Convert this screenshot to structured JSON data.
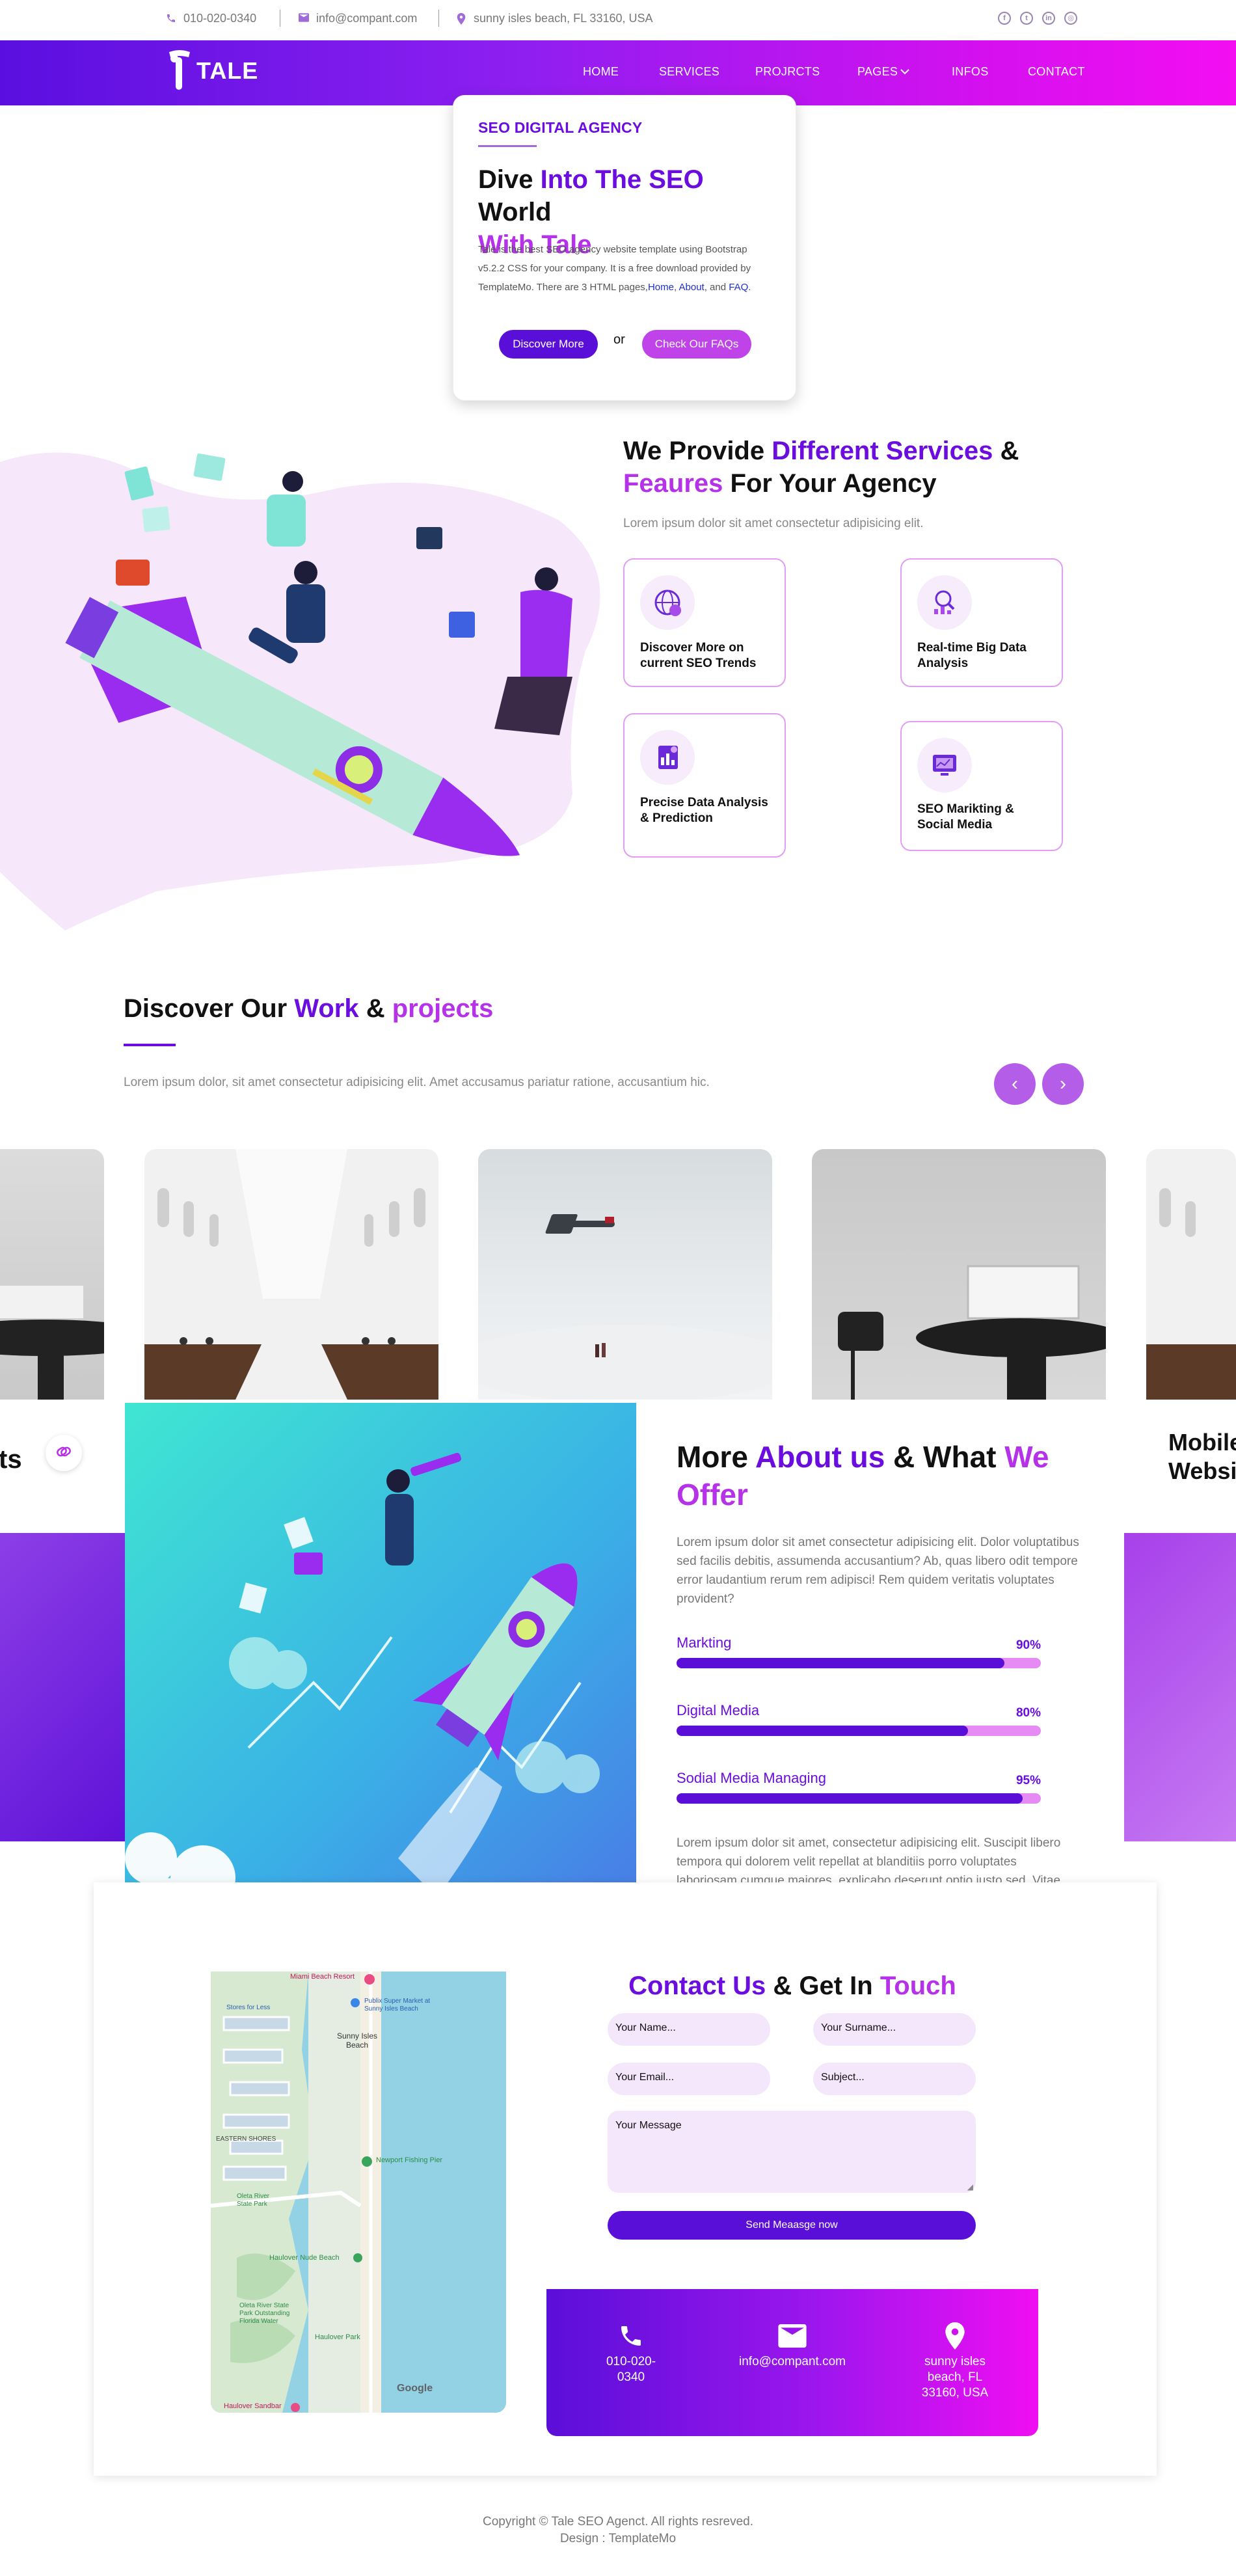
{
  "topbar": {
    "phone": "010-020-0340",
    "email": "info@compant.com",
    "address": "sunny isles beach, FL 33160, USA",
    "social_icons": [
      "facebook-icon",
      "twitter-icon",
      "linkedin-icon",
      "instagram-icon"
    ]
  },
  "brand": {
    "name": "TALE"
  },
  "nav": {
    "items": [
      {
        "label": "HOME"
      },
      {
        "label": "SERVICES"
      },
      {
        "label": "PROJRCTS"
      },
      {
        "label": "PAGES"
      },
      {
        "label": "INFOS"
      },
      {
        "label": "CONTACT"
      }
    ]
  },
  "hero": {
    "kicker": "SEO DIGITAL AGENCY",
    "title_part1": "Dive ",
    "title_part2": "Into The SEO",
    "title_part3": " World",
    "title_part4": "With Tale",
    "desc_text": "Tale is the best SEO agency website template using Bootstrap v5.2.2 CSS for your company. It is a free download provided by TemplateMo. There are 3 HTML pages,",
    "link_home": "Home",
    "link_about": "About",
    "link_and": ", and ",
    "link_faq": "FAQ",
    "primary_button": "Discover More",
    "or_text": "or",
    "secondary_button": "Check Our FAQs"
  },
  "services": {
    "title_part1": "We Provide ",
    "title_part2": "Different Services",
    "title_part3": " &",
    "title_part4": "Feaures",
    "title_part5": " For Your Agency",
    "subtitle": "Lorem ipsum dolor sit amet consectetur adipisicing elit.",
    "cards": [
      {
        "label": "Discover More on current SEO Trends"
      },
      {
        "label": "Real-time Big Data Analysis"
      },
      {
        "label": "Precise Data Analysis & Prediction"
      },
      {
        "label": "SEO Marikting & Social Media"
      }
    ]
  },
  "work": {
    "title_part1": "Discover Our ",
    "title_part2": "Work",
    "title_part3": " & ",
    "title_part4": "projects",
    "subtitle": "Lorem ipsum dolor, sit amet consectetur adipisicing elit. Amet accusamus pariatur ratione, accusantium hic.",
    "prev_icon": "‹",
    "next_icon": "›",
    "left_card_text": "ts",
    "right_card_text_1": "Mobile",
    "right_card_text_2": "Websi"
  },
  "about": {
    "title_part1": "More ",
    "title_part2": "About us",
    "title_part3": " & What ",
    "title_part4": "We",
    "title_part5": "Offer",
    "desc": "Lorem ipsum dolor sit amet consectetur adipisicing elit. Dolor voluptatibus sed facilis debitis, assumenda accusantium? Ab, quas libero odit tempore error laudantium rerum rem adipisci! Rem quidem veritatis voluptates provident?",
    "skills": [
      {
        "label": "Markting",
        "percent_text": "90%",
        "value": 90
      },
      {
        "label": "Digital Media",
        "percent_text": "80%",
        "value": 80
      },
      {
        "label": "Sodial Media Managing",
        "percent_text": "95%",
        "value": 95
      }
    ],
    "desc2": "Lorem ipsum dolor sit amet, consectetur adipisicing elit. Suscipit libero tempora qui dolorem velit repellat at blanditiis porro voluptates laboriosam cumque maiores, explicabo deserunt optio iusto sed. Vitae, laudantium consectetur."
  },
  "contact": {
    "title_part1": "Contact Us",
    "title_part2": " & Get In ",
    "title_part3": "Touch",
    "name_placeholder": "Your Name...",
    "surname_placeholder": "Your Surname...",
    "email_placeholder": "Your Email...",
    "subject_placeholder": "Subject...",
    "message_placeholder": "Your Message",
    "send_button": "Send Meaasge now",
    "info_phone": "010-020-0340",
    "info_email": "info@compant.com",
    "info_address": "sunny isles beach, FL 33160, USA"
  },
  "map": {
    "labels": {
      "miami_beach": "Miami Beach Resort",
      "publix": "Publix Super Market at Sunny Isles Beach",
      "sunny_isles": "Sunny Isles Beach",
      "eastern_shores": "EASTERN SHORES",
      "pier": "Newport Fishing Pier",
      "oleta": "Oleta River State Park",
      "haulover_nude": "Haulover Nude Beach",
      "oleta2": "Oleta River State Park Outstanding Florida Water",
      "haulover_park": "Haulover Park",
      "haulover_sandbar": "Haulover Sandbar",
      "stores": "Stores for Less",
      "google": "Google"
    }
  },
  "footer": {
    "copyright": "Copyright © Tale SEO Agenct. All rights resreved.",
    "design": "Design : TemplateMo"
  },
  "colors": {
    "violet": "#6a0dde",
    "magenta": "#b532e8",
    "nav_start": "#5a0fe0",
    "nav_end": "#f40ef2"
  }
}
